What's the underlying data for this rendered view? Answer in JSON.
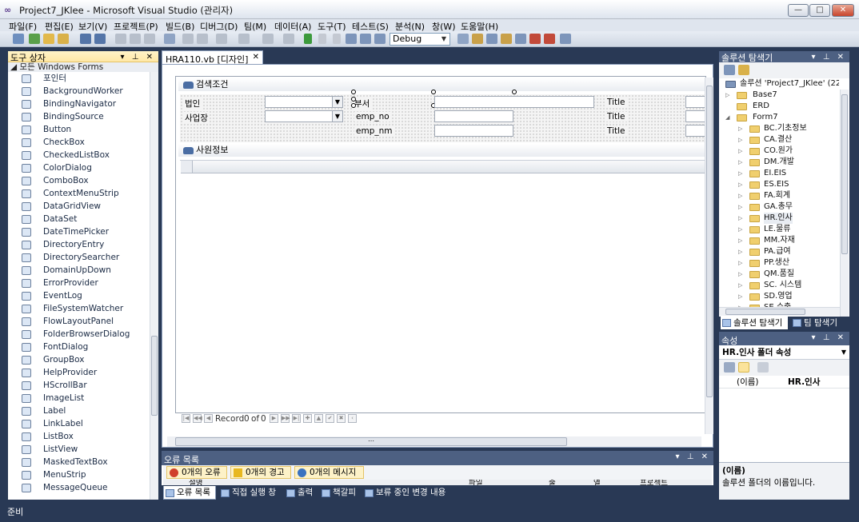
{
  "window": {
    "title": "Project7_JKlee - Microsoft Visual Studio (관리자)",
    "icon_text": "∞"
  },
  "menu": [
    "파일(F)",
    "편집(E)",
    "보기(V)",
    "프로젝트(P)",
    "빌드(B)",
    "디버그(D)",
    "팀(M)",
    "데이터(A)",
    "도구(T)",
    "테스트(S)",
    "분석(N)",
    "창(W)",
    "도움말(H)"
  ],
  "toolbar": {
    "config": "Debug"
  },
  "toolbox": {
    "title": "도구 상자",
    "section": "◢ 모든 Windows Forms",
    "items": [
      "포인터",
      "BackgroundWorker",
      "BindingNavigator",
      "BindingSource",
      "Button",
      "CheckBox",
      "CheckedListBox",
      "ColorDialog",
      "ComboBox",
      "ContextMenuStrip",
      "DataGridView",
      "DataSet",
      "DateTimePicker",
      "DirectoryEntry",
      "DirectorySearcher",
      "DomainUpDown",
      "ErrorProvider",
      "EventLog",
      "FileSystemWatcher",
      "FlowLayoutPanel",
      "FolderBrowserDialog",
      "FontDialog",
      "GroupBox",
      "HelpProvider",
      "HScrollBar",
      "ImageList",
      "Label",
      "LinkLabel",
      "ListBox",
      "ListView",
      "MaskedTextBox",
      "MenuStrip",
      "MessageQueue"
    ]
  },
  "document": {
    "tab": "HRA110.vb [디자인]",
    "search_group": "검색조건",
    "labels": {
      "corp": "법인",
      "site": "사업장",
      "dept": "부서",
      "emp_no": "emp_no",
      "emp_nm": "emp_nm",
      "title1": "Title",
      "title2": "Title",
      "title3": "Title"
    },
    "grid_group": "사원정보",
    "nav": {
      "record_label": "Record",
      "position": "0",
      "of": "of",
      "count": "0"
    }
  },
  "error_list": {
    "title": "오류 목록",
    "errors": "0개의 오류",
    "warnings": "0개의 경고",
    "messages": "0개의 메시지",
    "columns": [
      "설명",
      "파일",
      "줄",
      "열",
      "프로젝트"
    ]
  },
  "bottom_tabs": [
    "오류 목록",
    "직접 실행 창",
    "출력",
    "책갈피",
    "보류 중인 변경 내용"
  ],
  "solution": {
    "title": "솔루션 탐색기",
    "root": "솔루션 'Project7_JKlee' (22",
    "nodes": [
      "Base7",
      "ERD",
      "Form7"
    ],
    "folders": [
      "BC.기초정보",
      "CA.결산",
      "CO.원가",
      "DM.개발",
      "EI.EIS",
      "ES.EIS",
      "FA.회계",
      "GA.총무",
      "HR.인사",
      "LE.물류",
      "MM.자재",
      "PA.급여",
      "PP.생산",
      "QM.품질",
      "SC. 시스템",
      "SD.영업",
      "SE.수출"
    ],
    "tabs": [
      "솔루션 탐색기",
      "팀 탐색기"
    ]
  },
  "properties": {
    "title": "속성",
    "object": "HR.인사 폴더 속성",
    "row_name": "(이름)",
    "row_value": "HR.인사",
    "desc_title": "(이름)",
    "desc_text": "솔루션 폴더의 이름입니다."
  },
  "status": "준비"
}
